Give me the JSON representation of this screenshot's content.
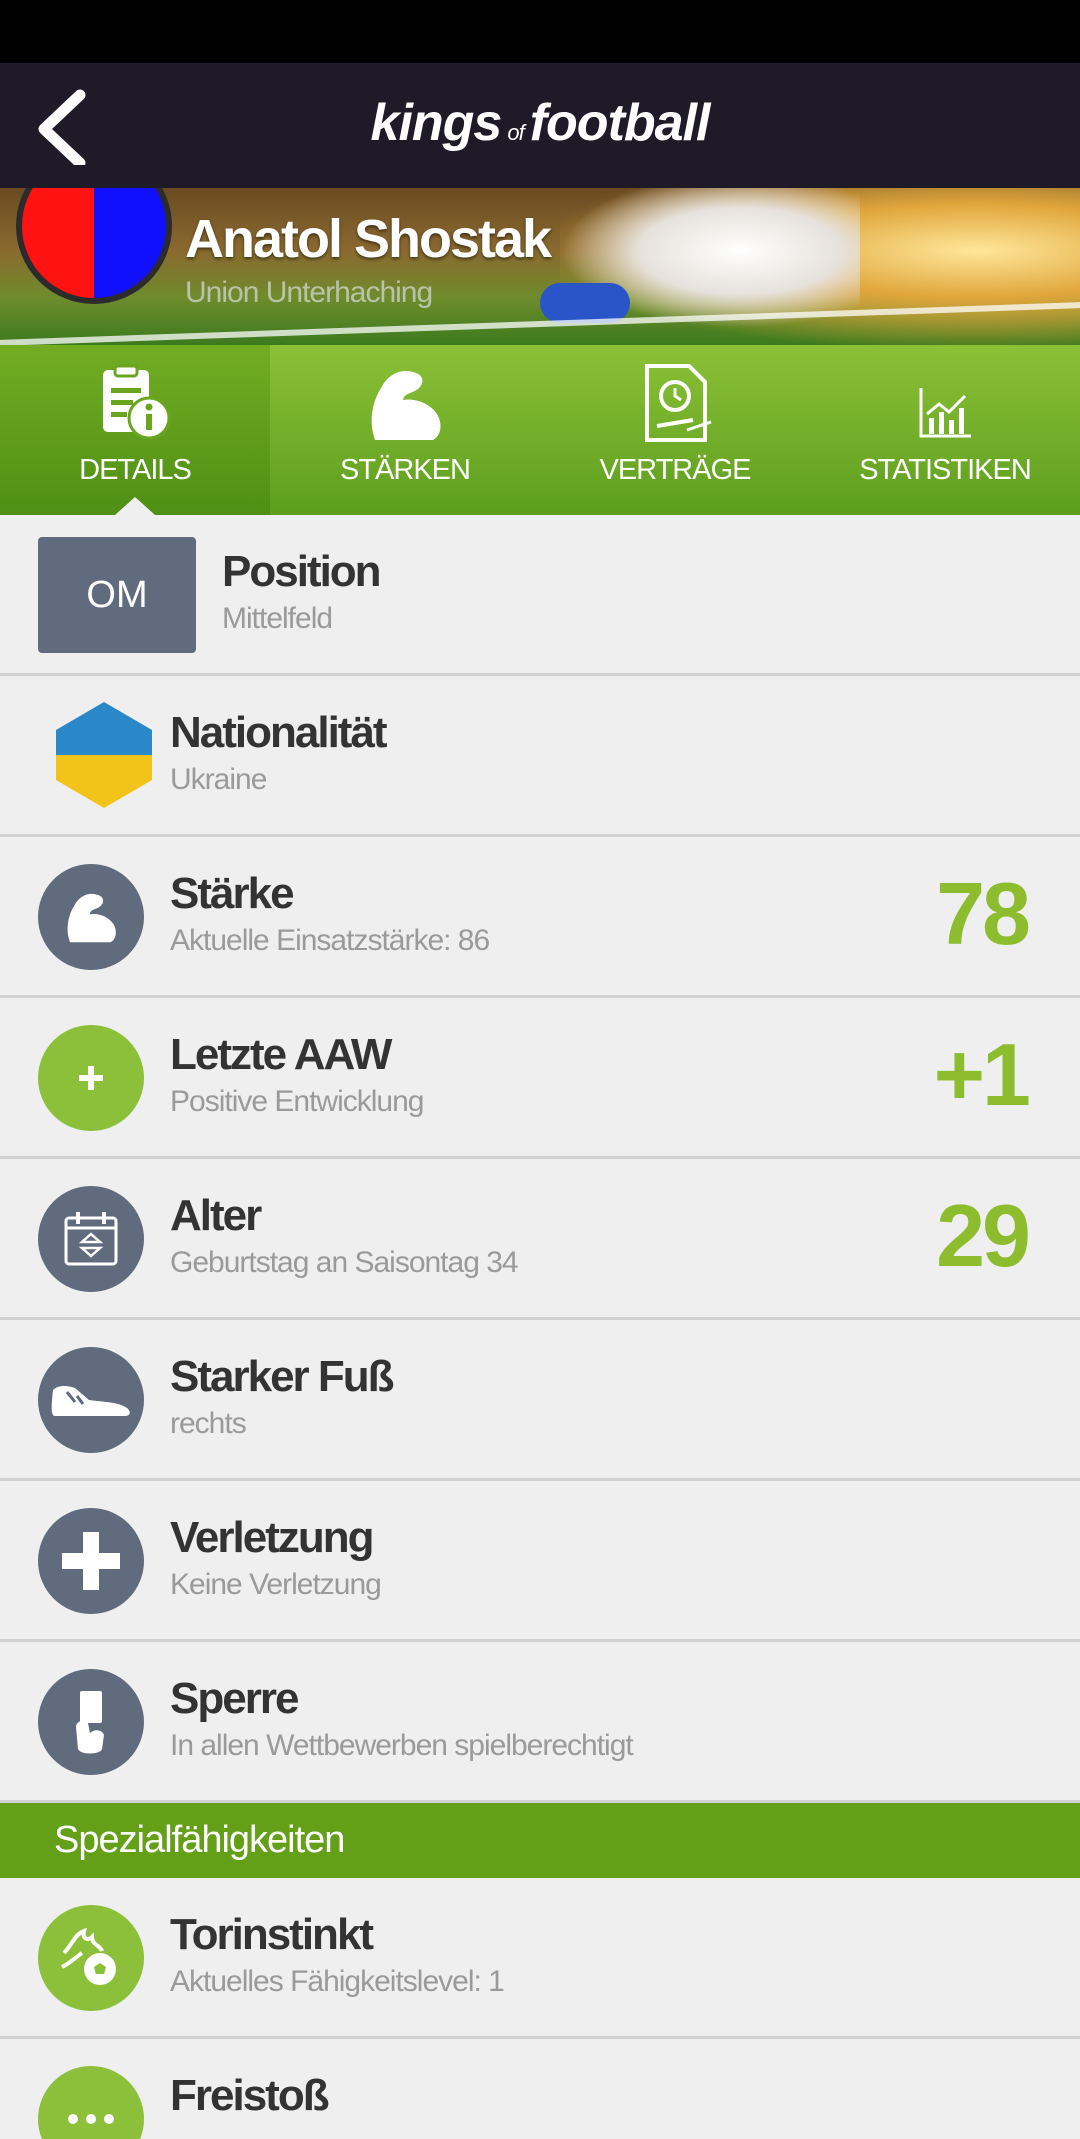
{
  "app": {
    "logo_left": "kings",
    "logo_of": "of",
    "logo_right": "football"
  },
  "player": {
    "name": "Anatol Shostak",
    "club": "Union Unterhaching",
    "club_colors": [
      "#ff1212",
      "#1010ff"
    ]
  },
  "tabs": [
    {
      "label": "DETAILS",
      "icon": "document-info-icon",
      "active": true
    },
    {
      "label": "STÄRKEN",
      "icon": "flexed-arm-icon",
      "active": false
    },
    {
      "label": "VERTRÄGE",
      "icon": "contract-clock-icon",
      "active": false
    },
    {
      "label": "STATISTIKEN",
      "icon": "bar-chart-icon",
      "active": false
    }
  ],
  "details": {
    "position": {
      "badge": "OM",
      "title": "Position",
      "sub": "Mittelfeld"
    },
    "nationality": {
      "title": "Nationalität",
      "sub": "Ukraine",
      "flag_colors": [
        "#2a87c8",
        "#f2c318"
      ]
    },
    "strength": {
      "title": "Stärke",
      "sub": "Aktuelle Einsatzstärke: 86",
      "value": "78"
    },
    "aaw": {
      "title": "Letzte AAW",
      "sub": "Positive Entwicklung",
      "value": "+1"
    },
    "age": {
      "title": "Alter",
      "sub": "Geburtstag an Saisontag 34",
      "value": "29"
    },
    "foot": {
      "title": "Starker Fuß",
      "sub": "rechts"
    },
    "injury": {
      "title": "Verletzung",
      "sub": "Keine Verletzung"
    },
    "ban": {
      "title": "Sperre",
      "sub": "In allen Wettbewerben spielberechtigt"
    }
  },
  "special": {
    "header": "Spezialfähigkeiten",
    "items": [
      {
        "title": "Torinstinkt",
        "sub": "Aktuelles Fähigkeitslevel: 1"
      },
      {
        "title": "Freistoß",
        "sub": ""
      }
    ]
  },
  "colors": {
    "accent_green": "#8dbd2e",
    "icon_gray": "#606b7d",
    "appbar": "#1f1a28"
  }
}
